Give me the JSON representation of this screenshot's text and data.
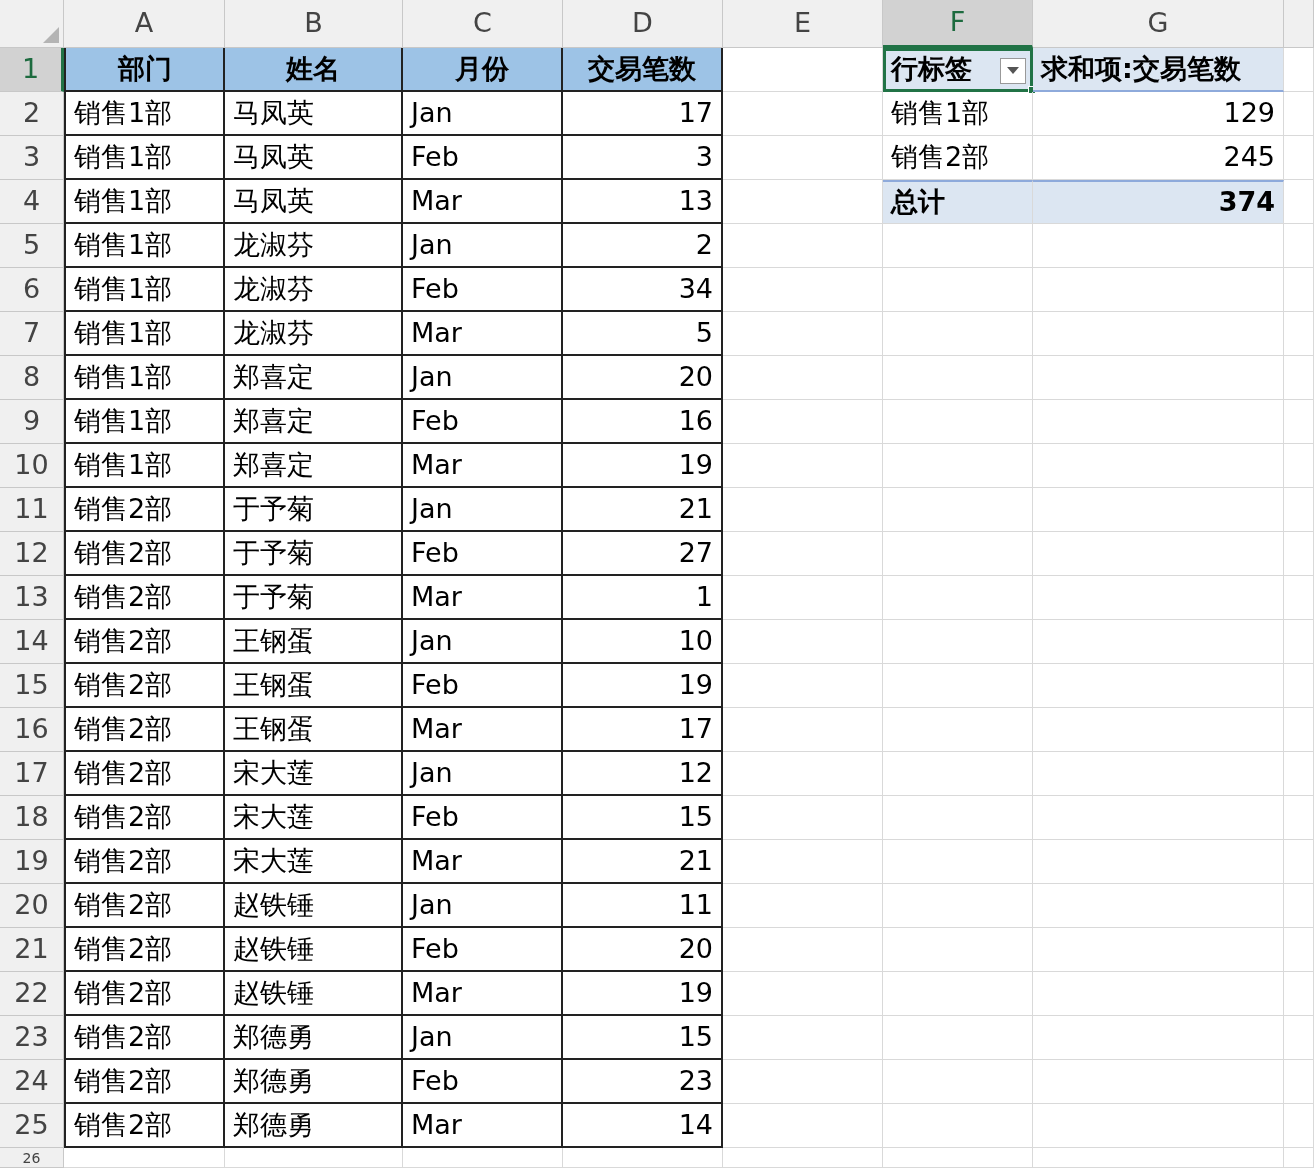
{
  "column_headers": [
    {
      "label": "A",
      "selected": false
    },
    {
      "label": "B",
      "selected": false
    },
    {
      "label": "C",
      "selected": false
    },
    {
      "label": "D",
      "selected": false
    },
    {
      "label": "E",
      "selected": false
    },
    {
      "label": "F",
      "selected": true
    },
    {
      "label": "G",
      "selected": false
    }
  ],
  "row_headers": [
    {
      "label": "1",
      "selected": true
    },
    {
      "label": "2",
      "selected": false
    },
    {
      "label": "3",
      "selected": false
    },
    {
      "label": "4",
      "selected": false
    },
    {
      "label": "5",
      "selected": false
    },
    {
      "label": "6",
      "selected": false
    },
    {
      "label": "7",
      "selected": false
    },
    {
      "label": "8",
      "selected": false
    },
    {
      "label": "9",
      "selected": false
    },
    {
      "label": "10",
      "selected": false
    },
    {
      "label": "11",
      "selected": false
    },
    {
      "label": "12",
      "selected": false
    },
    {
      "label": "13",
      "selected": false
    },
    {
      "label": "14",
      "selected": false
    },
    {
      "label": "15",
      "selected": false
    },
    {
      "label": "16",
      "selected": false
    },
    {
      "label": "17",
      "selected": false
    },
    {
      "label": "18",
      "selected": false
    },
    {
      "label": "19",
      "selected": false
    },
    {
      "label": "20",
      "selected": false
    },
    {
      "label": "21",
      "selected": false
    },
    {
      "label": "22",
      "selected": false
    },
    {
      "label": "23",
      "selected": false
    },
    {
      "label": "24",
      "selected": false
    },
    {
      "label": "25",
      "selected": false
    },
    {
      "label": "26",
      "selected": false
    }
  ],
  "table": {
    "header": [
      "部门",
      "姓名",
      "月份",
      "交易笔数"
    ],
    "rows": [
      [
        "销售1部",
        "马凤英",
        "Jan",
        "17"
      ],
      [
        "销售1部",
        "马凤英",
        "Feb",
        "3"
      ],
      [
        "销售1部",
        "马凤英",
        "Mar",
        "13"
      ],
      [
        "销售1部",
        "龙淑芬",
        "Jan",
        "2"
      ],
      [
        "销售1部",
        "龙淑芬",
        "Feb",
        "34"
      ],
      [
        "销售1部",
        "龙淑芬",
        "Mar",
        "5"
      ],
      [
        "销售1部",
        "郑喜定",
        "Jan",
        "20"
      ],
      [
        "销售1部",
        "郑喜定",
        "Feb",
        "16"
      ],
      [
        "销售1部",
        "郑喜定",
        "Mar",
        "19"
      ],
      [
        "销售2部",
        "于予菊",
        "Jan",
        "21"
      ],
      [
        "销售2部",
        "于予菊",
        "Feb",
        "27"
      ],
      [
        "销售2部",
        "于予菊",
        "Mar",
        "1"
      ],
      [
        "销售2部",
        "王钢蛋",
        "Jan",
        "10"
      ],
      [
        "销售2部",
        "王钢蛋",
        "Feb",
        "19"
      ],
      [
        "销售2部",
        "王钢蛋",
        "Mar",
        "17"
      ],
      [
        "销售2部",
        "宋大莲",
        "Jan",
        "12"
      ],
      [
        "销售2部",
        "宋大莲",
        "Feb",
        "15"
      ],
      [
        "销售2部",
        "宋大莲",
        "Mar",
        "21"
      ],
      [
        "销售2部",
        "赵铁锤",
        "Jan",
        "11"
      ],
      [
        "销售2部",
        "赵铁锤",
        "Feb",
        "20"
      ],
      [
        "销售2部",
        "赵铁锤",
        "Mar",
        "19"
      ],
      [
        "销售2部",
        "郑德勇",
        "Jan",
        "15"
      ],
      [
        "销售2部",
        "郑德勇",
        "Feb",
        "23"
      ],
      [
        "销售2部",
        "郑德勇",
        "Mar",
        "14"
      ]
    ]
  },
  "pivot": {
    "header": [
      "行标签",
      "求和项:交易笔数"
    ],
    "rows": [
      {
        "kind": "item",
        "label": "销售1部",
        "value": "129"
      },
      {
        "kind": "item",
        "label": "销售2部",
        "value": "245"
      },
      {
        "kind": "total",
        "label": "总计",
        "value": "374"
      }
    ]
  }
}
